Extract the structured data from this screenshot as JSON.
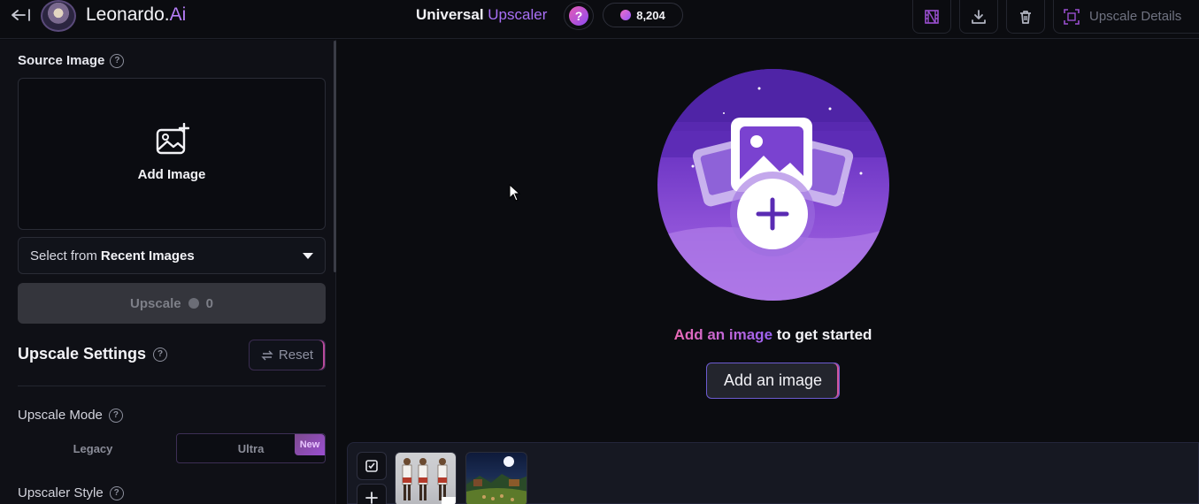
{
  "header": {
    "brand_name": "Leonardo.",
    "brand_suffix": "Ai",
    "title_main": "Universal",
    "title_accent": "Upscaler",
    "help_glyph": "?",
    "token_count": "8,204",
    "details_label": "Upscale Details",
    "icons": [
      "back-arrow-icon",
      "film-icon",
      "download-icon",
      "trash-icon",
      "scan-icon"
    ]
  },
  "sidebar": {
    "source_image_label": "Source Image",
    "add_image_label": "Add Image",
    "select_prefix": "Select from",
    "select_bold": "Recent Images",
    "upscale_label": "Upscale",
    "upscale_cost": "0",
    "settings_title": "Upscale Settings",
    "reset_label": "Reset",
    "mode_label": "Upscale Mode",
    "modes": [
      "Legacy",
      "Ultra"
    ],
    "selected_mode": "Ultra",
    "new_badge": "New",
    "style_label": "Upscaler Style"
  },
  "main": {
    "cta_highlight": "Add an image",
    "cta_rest": " to get started",
    "cta_button": "Add an image"
  },
  "colors": {
    "accent_purple": "#a970f6",
    "accent_pink": "#ec6bb6",
    "background": "#0b0c10"
  }
}
